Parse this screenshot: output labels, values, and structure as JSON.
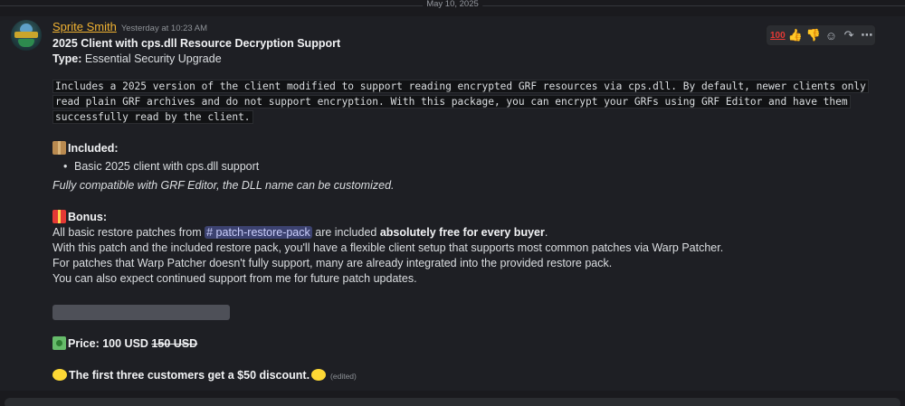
{
  "date_divider": "May 10, 2025",
  "message": {
    "author": "Sprite Smith",
    "timestamp": "Yesterday at 10:23 AM",
    "title": "2025 Client with cps.dll Resource Decryption Support",
    "type_label": "Type:",
    "type_value": " Essential Security Upgrade",
    "codeblock": "Includes a 2025 version of the client modified to support reading encrypted GRF resources via cps.dll. By default, newer clients only read plain GRF archives and do not support encryption. With this package, you can encrypt your GRFs using GRF Editor and have them successfully read by the client.",
    "included_heading": "Included:",
    "included_items": [
      "Basic 2025 client with cps.dll support"
    ],
    "included_note": "Fully compatible with GRF Editor, the DLL name can be customized.",
    "bonus_heading": "Bonus:",
    "bonus_line1_pre": "All basic restore patches from ",
    "bonus_channel": "# patch-restore-pack",
    "bonus_line1_mid": " are included ",
    "bonus_line1_bold": "absolutely free for every buyer",
    "bonus_line1_post": ".",
    "bonus_line2": "With this patch and the included restore pack, you'll have a flexible client setup that supports most common patches via Warp Patcher.",
    "bonus_line3": "For patches that Warp Patcher doesn't fully support, many are already integrated into the provided restore pack.",
    "bonus_line4": "You can also expect continued support from me for future patch updates.",
    "price_label": "Price: 100 USD ",
    "price_old": "150 USD",
    "discount": "The first three customers get a $50 discount.",
    "edited": "(edited)"
  },
  "reactions": {
    "hundred": "100",
    "thumbs_up": "👍",
    "thumbs_down": "👎",
    "add_reaction": "☺",
    "forward": "↷",
    "more": "⋯"
  }
}
